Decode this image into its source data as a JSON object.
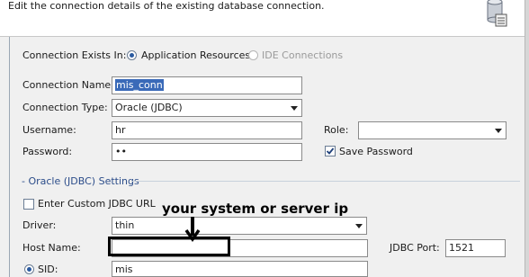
{
  "header": {
    "description": "Edit the connection details of the existing database connection."
  },
  "connection_exists": {
    "label": "Connection Exists In:",
    "options": [
      {
        "label": "Application Resources",
        "selected": true,
        "enabled": true
      },
      {
        "label": "IDE Connections",
        "selected": false,
        "enabled": false
      }
    ]
  },
  "form": {
    "connection_name": {
      "label": "Connection Name:",
      "value": "mis_conn"
    },
    "connection_type": {
      "label": "Connection Type:",
      "value": "Oracle (JDBC)"
    },
    "username": {
      "label": "Username:",
      "value": "hr"
    },
    "password": {
      "label": "Password:",
      "value": "••"
    },
    "role": {
      "label": "Role:",
      "value": ""
    },
    "save_password": {
      "label": "Save Password",
      "checked": true
    }
  },
  "oracle_settings": {
    "section_title": "- Oracle (JDBC) Settings",
    "custom_jdbc_url": {
      "label": "Enter Custom JDBC URL",
      "checked": false
    },
    "driver": {
      "label": "Driver:",
      "value": "thin"
    },
    "host_name": {
      "label": "Host Name:",
      "value": ""
    },
    "jdbc_port": {
      "label": "JDBC Port:",
      "value": "1521"
    },
    "sid": {
      "label": "SID:",
      "value": "mis"
    }
  },
  "annotation": {
    "text": "your system or server ip"
  }
}
